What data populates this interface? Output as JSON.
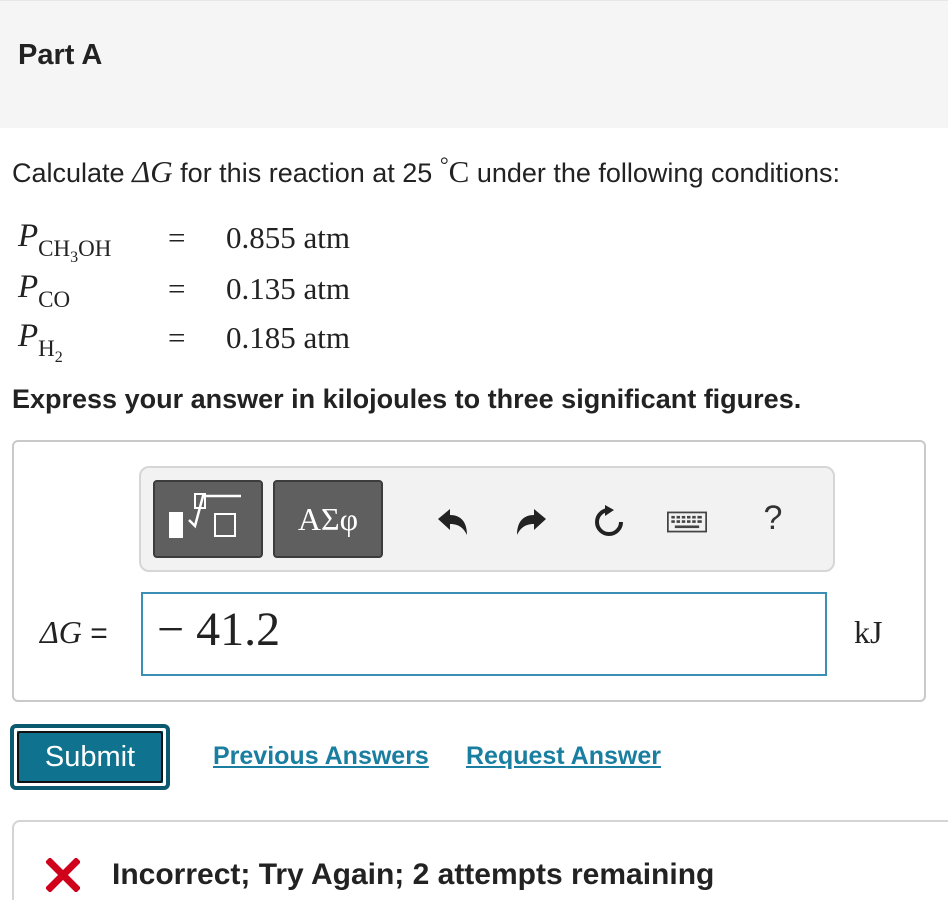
{
  "part": {
    "title": "Part A"
  },
  "question": {
    "prefix": "Calculate ",
    "delta_g": "ΔG",
    "middle": " for this reaction at 25 ",
    "degree": "°",
    "unit_c": "C",
    "suffix": " under the following conditions:"
  },
  "conditions": [
    {
      "var": "P",
      "sub": "CH",
      "subsub": "3",
      "sub_tail": "OH",
      "eq": "=",
      "value": "0.855 atm"
    },
    {
      "var": "P",
      "sub": "CO",
      "subsub": "",
      "sub_tail": "",
      "eq": "=",
      "value": "0.135 atm"
    },
    {
      "var": "P",
      "sub": "H",
      "subsub": "2",
      "sub_tail": "",
      "eq": "=",
      "value": "0.185 atm"
    }
  ],
  "instruction": "Express your answer in kilojoules to three significant figures.",
  "toolbar": {
    "symbols_label": "ΑΣφ",
    "help_label": "?",
    "icons": [
      "templates-icon",
      "undo-icon",
      "redo-icon",
      "reset-icon",
      "keyboard-icon",
      "help-icon"
    ]
  },
  "answer": {
    "label_math": "ΔG",
    "label_eq": " =",
    "value": "− 41.2",
    "unit": "kJ"
  },
  "actions": {
    "submit": "Submit",
    "previous_answers": "Previous Answers",
    "request_answer": "Request Answer"
  },
  "feedback": {
    "message": "Incorrect; Try Again; 2 attempts remaining",
    "color": "#d0021b"
  },
  "colors": {
    "accent": "#0f7390",
    "link": "#197ea0",
    "input_border": "#3b8fb5"
  }
}
